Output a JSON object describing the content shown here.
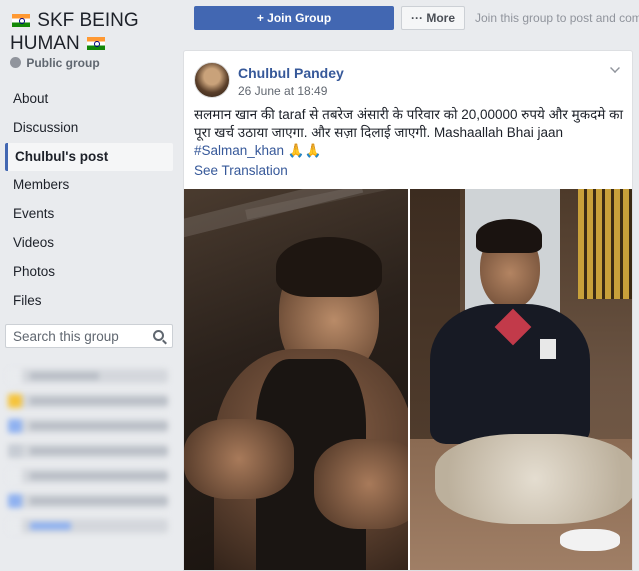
{
  "sidebar": {
    "group_title": "SKF BEING HUMAN",
    "privacy": "Public group",
    "nav": [
      {
        "label": "About"
      },
      {
        "label": "Discussion"
      },
      {
        "label": "Chulbul's post",
        "active": true
      },
      {
        "label": "Members"
      },
      {
        "label": "Events"
      },
      {
        "label": "Videos"
      },
      {
        "label": "Photos"
      },
      {
        "label": "Files"
      }
    ],
    "search_placeholder": "Search this group"
  },
  "topbar": {
    "join_label": "+ Join Group",
    "more_label": "··· More",
    "hint": "Join this group to post and comment"
  },
  "post": {
    "author": "Chulbul Pandey",
    "time": "26 June at 18:49",
    "text": "सलमान खान की taraf से तबरेज अंसारी के परिवार को 20,00000 रुपये और मुकदमे का पूरा खर्च उठाया जाएगा. और सज़ा दिलाई जाएगी. Mashaallah Bhai jaan",
    "hashtag": "#Salman_khan",
    "emoji": "🙏🙏",
    "see_translation": "See Translation"
  },
  "colors": {
    "brand": "#4267b2",
    "link": "#365899",
    "background": "#e9ebee"
  }
}
